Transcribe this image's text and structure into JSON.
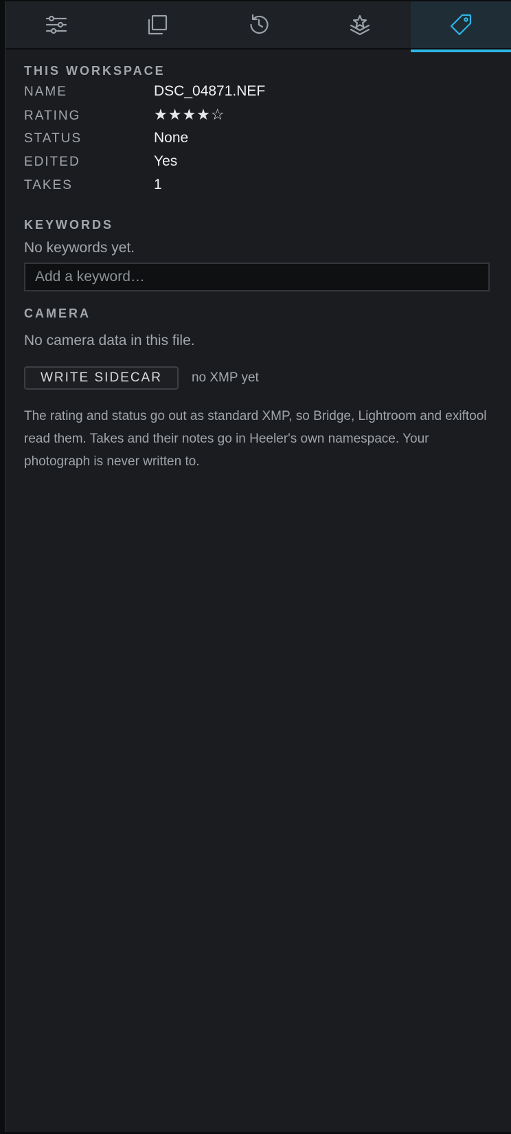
{
  "tabs": [
    {
      "icon": "sliders-icon",
      "active": false
    },
    {
      "icon": "copy-icon",
      "active": false
    },
    {
      "icon": "history-icon",
      "active": false
    },
    {
      "icon": "layers-star-icon",
      "active": false
    },
    {
      "icon": "tag-icon",
      "active": true
    }
  ],
  "accent_color": "#2fb4e6",
  "workspace": {
    "title": "THIS WORKSPACE",
    "rows": {
      "name": {
        "label": "NAME",
        "value": "DSC_04871.NEF"
      },
      "rating": {
        "label": "RATING",
        "value": 4,
        "max": 5,
        "stars": "★★★★☆"
      },
      "status": {
        "label": "STATUS",
        "value": "None"
      },
      "edited": {
        "label": "EDITED",
        "value": "Yes"
      },
      "takes": {
        "label": "TAKES",
        "value": "1"
      }
    }
  },
  "keywords": {
    "title": "KEYWORDS",
    "empty_text": "No keywords yet.",
    "input_value": "",
    "input_placeholder": "Add a keyword…"
  },
  "camera": {
    "title": "CAMERA",
    "empty_text": "No camera data in this file."
  },
  "sidecar": {
    "button_label": "WRITE SIDECAR",
    "status_text": "no XMP yet",
    "info_text": "The rating and status go out as standard XMP, so Bridge, Lightroom and exiftool read them. Takes and their notes go in Heeler's own namespace. Your photograph is never written to."
  }
}
